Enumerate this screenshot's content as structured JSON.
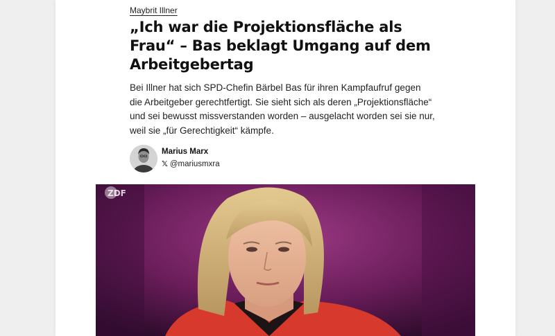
{
  "article": {
    "kicker": "Maybrit Illner",
    "headline": "„Ich war die Projektionsfläche als Frau“ – Bas beklagt Umgang auf dem Arbeitgebertag",
    "lead": "Bei Illner hat sich SPD-Chefin Bärbel Bas für ihren Kampfaufruf gegen die Arbeitgeber gerechtfertigt. Sie sieht sich als deren „Projektionsfläche“ und sei bewusst missverstanden worden – ausgelacht worden sei sie nur, weil sie „für Gerechtigkeit“ kämpfe."
  },
  "author": {
    "name": "Marius Marx",
    "social_icon": "x-icon",
    "handle": "@mariusmxra"
  },
  "hero": {
    "broadcaster_logo": "ZDF"
  },
  "colors": {
    "page_background": "#efefef",
    "card_background": "#ffffff",
    "studio_purple": "#6d1f5c",
    "jacket_red": "#d73a2c"
  }
}
